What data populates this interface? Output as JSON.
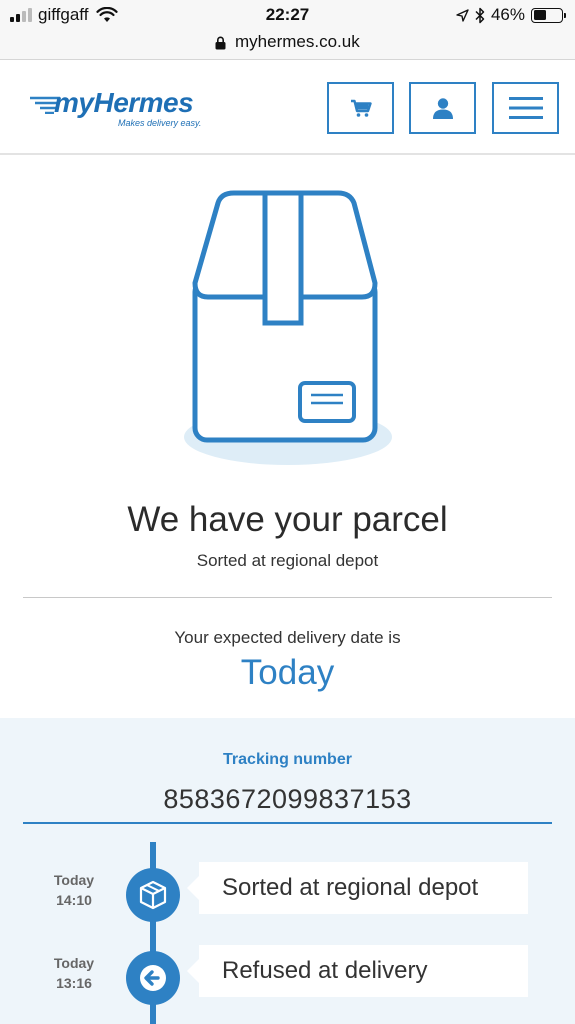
{
  "status_bar": {
    "carrier": "giffgaff",
    "time": "22:27",
    "battery": "46%"
  },
  "url_bar": {
    "url": "myhermes.co.uk"
  },
  "header": {
    "logo_text": "myHermes",
    "logo_tagline": "Makes delivery easy.",
    "buttons": [
      {
        "icon": "cart-icon"
      },
      {
        "icon": "user-icon"
      },
      {
        "icon": "menu-icon"
      }
    ]
  },
  "parcel_status": {
    "title": "We have your parcel",
    "subtitle": "Sorted at regional depot",
    "expected_label": "Your expected delivery date is",
    "expected_date": "Today"
  },
  "tracking": {
    "label": "Tracking number",
    "number": "8583672099837153",
    "events": [
      {
        "day": "Today",
        "time": "14:10",
        "icon": "box-icon",
        "description": "Sorted at regional depot"
      },
      {
        "day": "Today",
        "time": "13:16",
        "icon": "arrow-left-icon",
        "description": "Refused at delivery"
      }
    ]
  },
  "colors": {
    "brand_blue": "#2e81c4",
    "section_background": "#eef5fa"
  }
}
